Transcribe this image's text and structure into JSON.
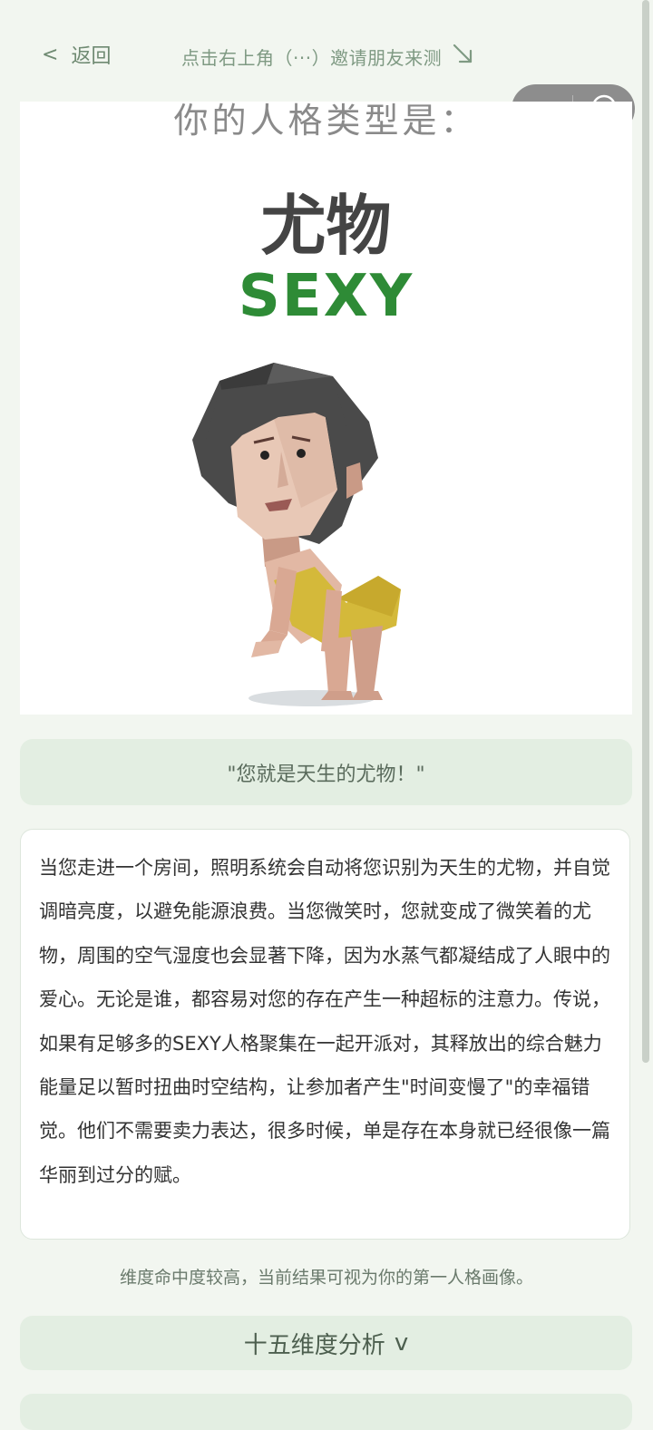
{
  "nav": {
    "back_glyph": "<",
    "back_label": "返回",
    "invite_text": "点击右上角（···）邀请朋友来测",
    "invite_arrow": "↘",
    "capsule": {
      "more_icon": "more-dots-icon",
      "close_icon": "target-icon"
    }
  },
  "hero": {
    "heading": "你的人格类型是：",
    "type_name": "尤物",
    "type_code": "SEXY",
    "code_color": "#2e8b36"
  },
  "quote": "\"您就是天生的尤物！\"",
  "description": "当您走进一个房间，照明系统会自动将您识别为天生的尤物，并自觉调暗亮度，以避免能源浪费。当您微笑时，您就变成了微笑着的尤物，周围的空气湿度也会显著下降，因为水蒸气都凝结成了人眼中的爱心。无论是谁，都容易对您的存在产生一种超标的注意力。传说，如果有足够多的SEXY人格聚集在一起开派对，其释放出的综合魅力能量足以暂时扭曲时空结构，让参加者产生\"时间变慢了\"的幸福错觉。他们不需要卖力表达，很多时候，单是存在本身就已经很像一篇华丽到过分的赋。",
  "note": "维度命中度较高，当前结果可视为你的第一人格画像。",
  "dimension": {
    "label": "十五维度分析",
    "chevron": "v"
  },
  "colors": {
    "background": "#f2f6f0",
    "card": "#e3eee2",
    "accent_green": "#2e8b36"
  }
}
